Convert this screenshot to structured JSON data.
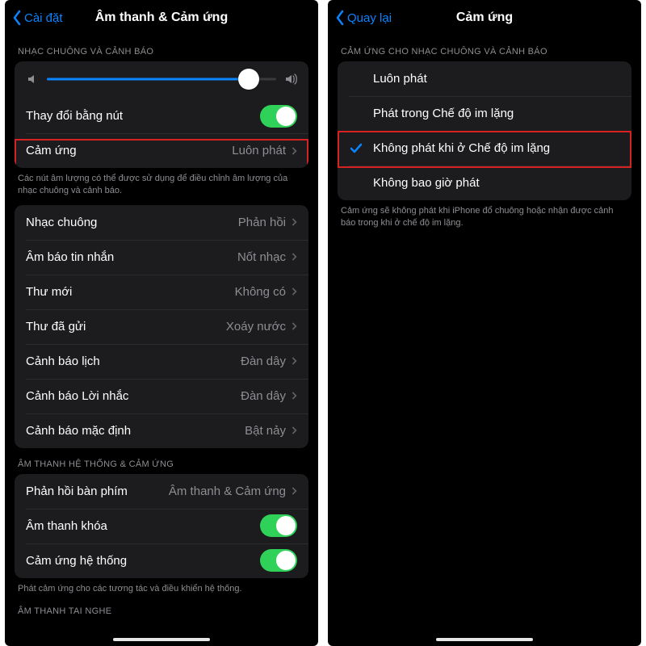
{
  "left": {
    "back_label": "Cài đặt",
    "title": "Âm thanh & Cảm ứng",
    "section1": "NHẠC CHUÔNG VÀ CẢNH BÁO",
    "volume_percent": 88,
    "change_with_buttons": {
      "label": "Thay đổi bằng nút",
      "on": true
    },
    "haptics_row": {
      "label": "Cảm ứng",
      "value": "Luôn phát"
    },
    "note1": "Các nút âm lượng có thể được sử dụng để điều chỉnh âm lượng của nhạc chuông và cảnh báo.",
    "sounds": [
      {
        "label": "Nhạc chuông",
        "value": "Phản hồi"
      },
      {
        "label": "Âm báo tin nhắn",
        "value": "Nốt nhạc"
      },
      {
        "label": "Thư mới",
        "value": "Không có"
      },
      {
        "label": "Thư đã gửi",
        "value": "Xoáy nước"
      },
      {
        "label": "Cảnh báo lịch",
        "value": "Đàn dây"
      },
      {
        "label": "Cảnh báo Lời nhắc",
        "value": "Đàn dây"
      },
      {
        "label": "Cảnh báo mặc định",
        "value": "Bật nảy"
      }
    ],
    "section2": "ÂM THANH HỆ THỐNG & CẢM ỨNG",
    "keyboard_row": {
      "label": "Phản hồi bàn phím",
      "value": "Âm thanh & Cảm ứng"
    },
    "lock_sound": {
      "label": "Âm thanh khóa",
      "on": true
    },
    "system_haptics": {
      "label": "Cảm ứng hệ thống",
      "on": true
    },
    "note2": "Phát cảm ứng cho các tương tác và điều khiển hệ thống.",
    "section3": "ÂM THANH TAI NGHE"
  },
  "right": {
    "back_label": "Quay lại",
    "title": "Cảm ứng",
    "section": "CẢM ỨNG CHO NHẠC CHUÔNG VÀ CẢNH BÁO",
    "options": [
      {
        "label": "Luôn phát",
        "selected": false
      },
      {
        "label": "Phát trong Chế độ im lặng",
        "selected": false
      },
      {
        "label": "Không phát khi ở Chế độ im lặng",
        "selected": true
      },
      {
        "label": "Không bao giờ phát",
        "selected": false
      }
    ],
    "note": "Cảm ứng sẽ không phát khi iPhone đổ chuông hoặc nhận được cảnh báo trong khi ở chế độ im lặng."
  }
}
